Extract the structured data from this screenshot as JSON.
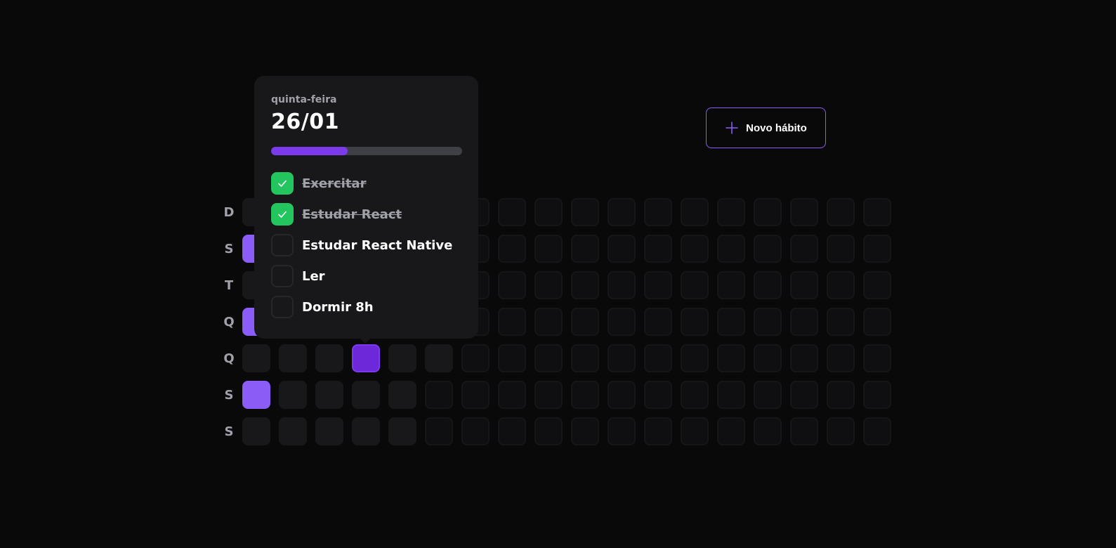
{
  "header": {
    "new_habit_label": "Novo hábito",
    "new_habit_icon": "plus-icon",
    "accent_color": "#8b5cf6"
  },
  "weekdays": [
    "D",
    "S",
    "T",
    "Q",
    "Q",
    "S",
    "S"
  ],
  "summary_grid": {
    "columns": 18,
    "rows": 7,
    "past_days_count": 40,
    "highlighted_cells": [
      {
        "column": 0,
        "row": 1,
        "level": "light"
      },
      {
        "column": 0,
        "row": 3,
        "level": "light"
      },
      {
        "column": 0,
        "row": 5,
        "level": "light"
      },
      {
        "column": 3,
        "row": 4,
        "level": "dark"
      }
    ]
  },
  "popover": {
    "weekday": "quinta-feira",
    "date": "26/01",
    "progress_fraction": 0.4,
    "habits": [
      {
        "title": "Exercitar",
        "completed": true
      },
      {
        "title": "Estudar React",
        "completed": true
      },
      {
        "title": "Estudar React Native",
        "completed": false
      },
      {
        "title": "Ler",
        "completed": false
      },
      {
        "title": "Dormir 8h",
        "completed": false
      }
    ]
  }
}
